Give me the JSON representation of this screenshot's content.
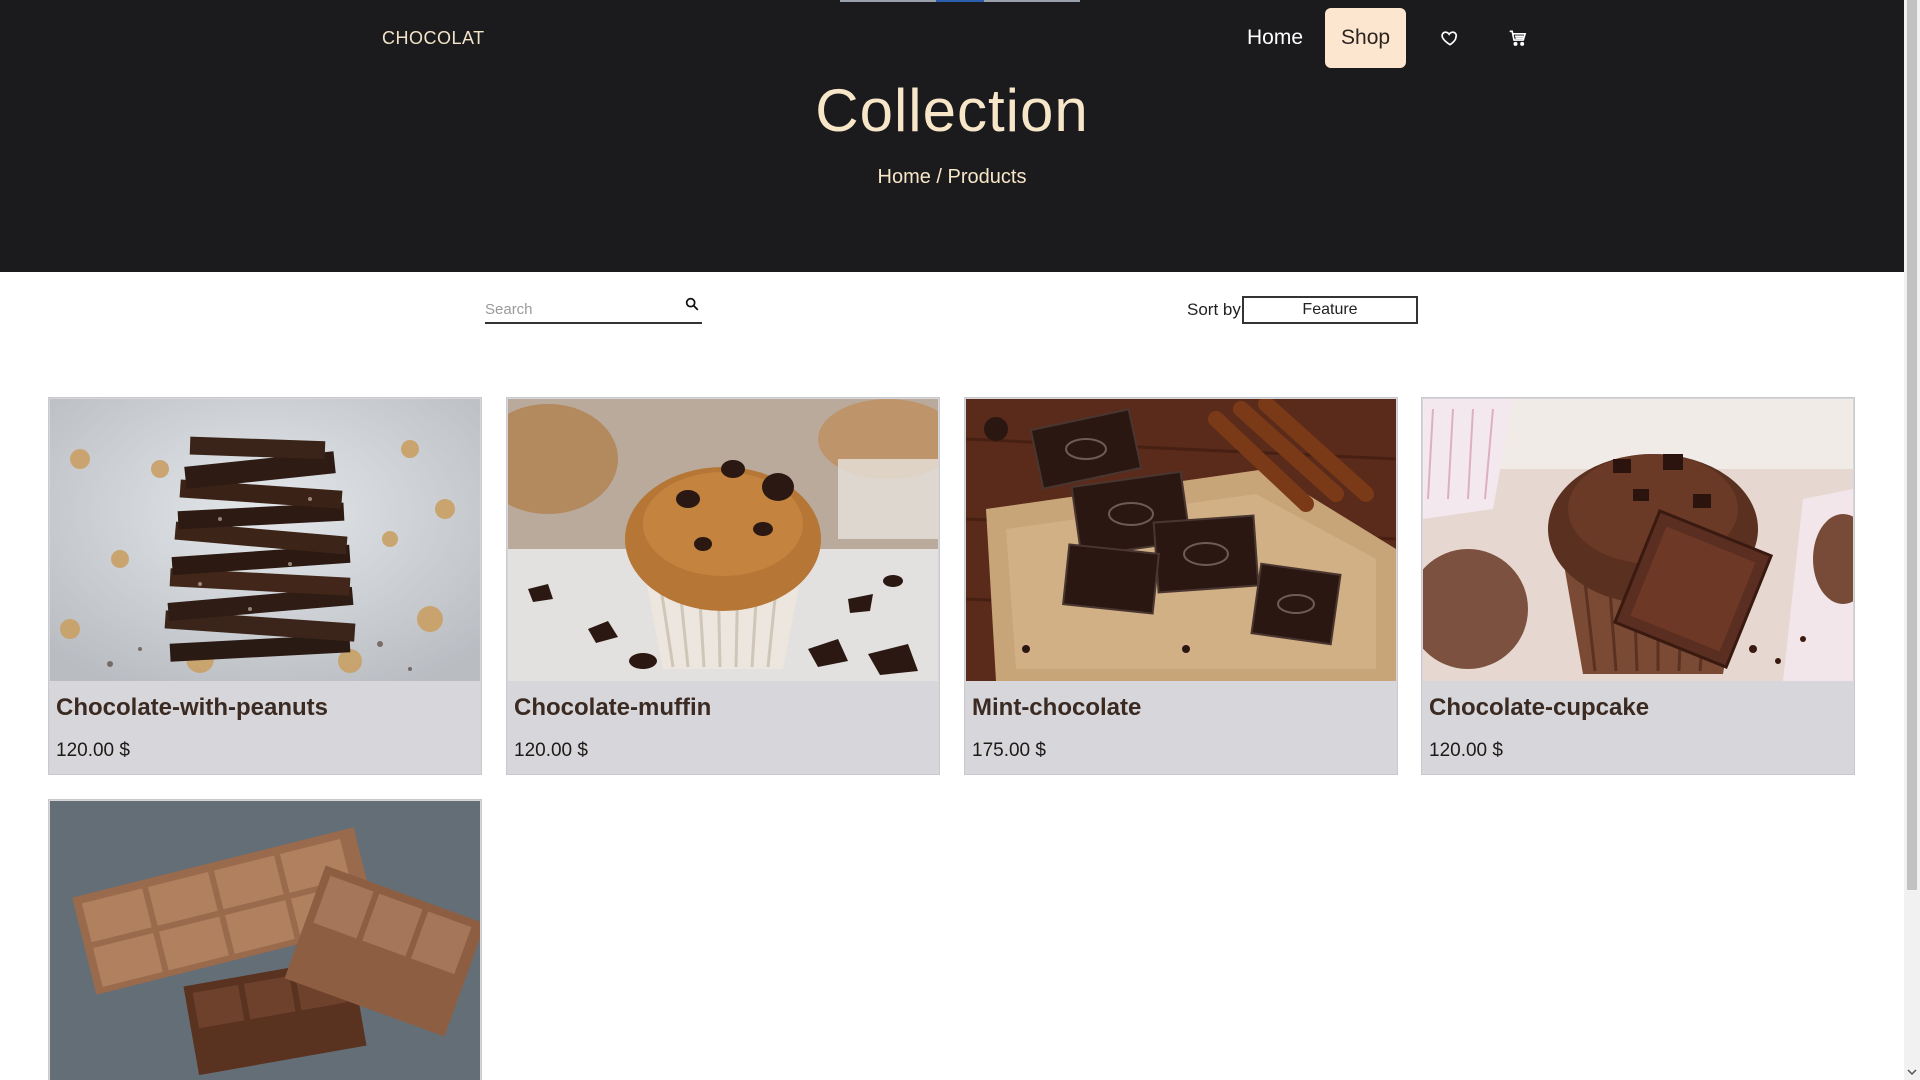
{
  "header": {
    "logo": "CHOCOLAT",
    "nav": {
      "home_label": "Home",
      "shop_label": "Shop",
      "wishlist_icon": "heart-icon",
      "cart_icon": "cart-icon"
    },
    "title": "Collection",
    "breadcrumb": {
      "home": "Home",
      "separator": " / ",
      "current": "Products"
    }
  },
  "toolbar": {
    "search": {
      "placeholder": "Search",
      "value": "",
      "icon": "search-icon"
    },
    "sort": {
      "label": "Sort by",
      "selected": "Feature"
    }
  },
  "products": [
    {
      "name": "Chocolate-with-peanuts",
      "price": "120.00 $"
    },
    {
      "name": "Chocolate-muffin",
      "price": "120.00 $"
    },
    {
      "name": "Mint-chocolate",
      "price": "175.00 $"
    },
    {
      "name": "Chocolate-cupcake",
      "price": "120.00 $"
    },
    {
      "name": "",
      "price": ""
    }
  ],
  "colors": {
    "hero_bg": "#1b1b1d",
    "title_text": "#f7e6c8",
    "active_nav_bg": "#fde6cf",
    "card_bg": "#d7d6da"
  }
}
